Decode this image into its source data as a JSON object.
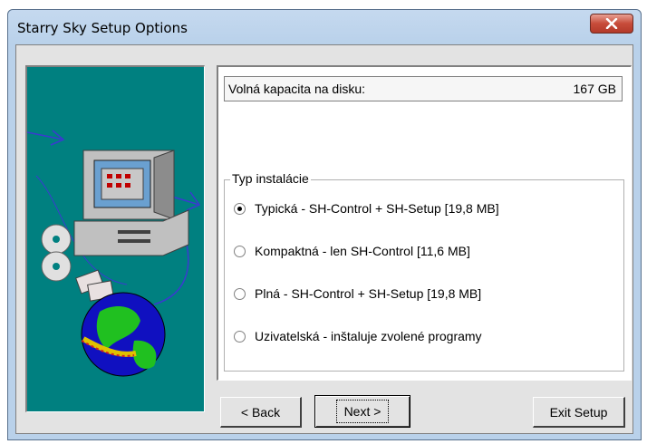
{
  "window": {
    "title": "Starry Sky Setup Options"
  },
  "disk": {
    "label": "Volná kapacita na disku:",
    "value": "167 GB"
  },
  "install_type": {
    "group_label": "Typ instalácie",
    "options": [
      {
        "label": "Typická - SH-Control + SH-Setup [19,8 MB]",
        "checked": true
      },
      {
        "label": "Kompaktná - len SH-Control [11,6 MB]",
        "checked": false
      },
      {
        "label": "Plná - SH-Control + SH-Setup [19,8 MB]",
        "checked": false
      },
      {
        "label": "Uzivatelská - inštaluje zvolené programy",
        "checked": false
      }
    ]
  },
  "buttons": {
    "back": "< Back",
    "next": "Next >",
    "exit": "Exit Setup"
  },
  "colors": {
    "sidebar_bg": "#008080",
    "title_bar": "#b9d1ea",
    "close_button": "#c74c3a"
  }
}
